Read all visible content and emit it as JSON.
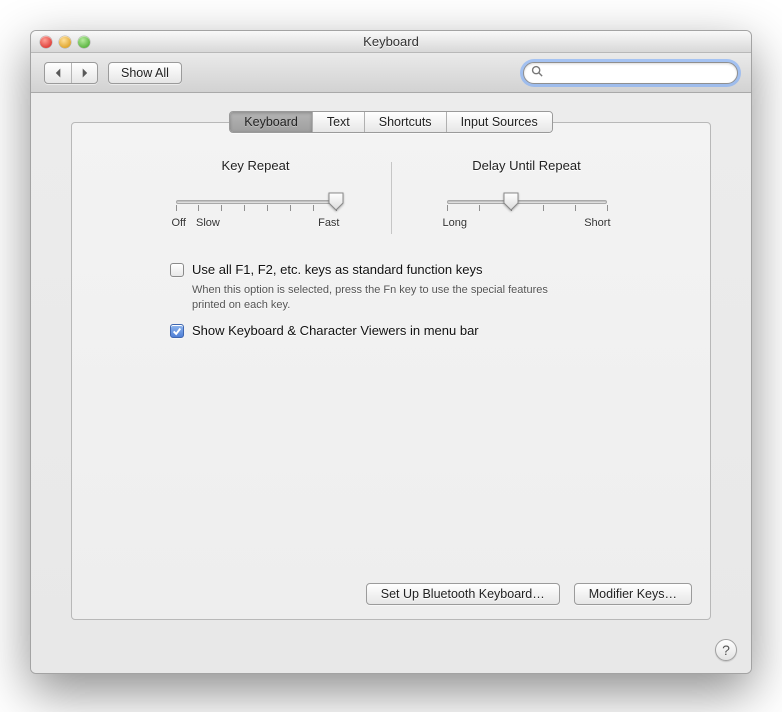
{
  "window": {
    "title": "Keyboard"
  },
  "toolbar": {
    "show_all": "Show All",
    "search_value": ""
  },
  "tabs": {
    "items": [
      {
        "label": "Keyboard",
        "selected": true
      },
      {
        "label": "Text",
        "selected": false
      },
      {
        "label": "Shortcuts",
        "selected": false
      },
      {
        "label": "Input Sources",
        "selected": false
      }
    ]
  },
  "sliders": {
    "key_repeat": {
      "title": "Key Repeat",
      "min_labels": [
        "Off",
        "Slow"
      ],
      "max_label": "Fast",
      "ticks": 8,
      "value_index": 7
    },
    "delay": {
      "title": "Delay Until Repeat",
      "min_label": "Long",
      "max_label": "Short",
      "ticks": 6,
      "value_index": 2
    }
  },
  "options": {
    "fn_keys": {
      "label": "Use all F1, F2, etc. keys as standard function keys",
      "description": "When this option is selected, press the Fn key to use the special features printed on each key.",
      "checked": false
    },
    "show_viewers": {
      "label": "Show Keyboard & Character Viewers in menu bar",
      "checked": true
    }
  },
  "buttons": {
    "bluetooth": "Set Up Bluetooth Keyboard…",
    "modifier": "Modifier Keys…"
  },
  "help": "?"
}
